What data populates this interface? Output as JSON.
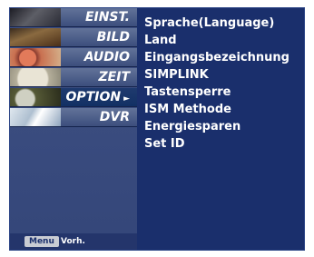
{
  "sidebar": {
    "items": [
      {
        "label": "EINST.",
        "thumbnail": "settings-thumbnail"
      },
      {
        "label": "BILD",
        "thumbnail": "picture-thumbnail"
      },
      {
        "label": "AUDIO",
        "thumbnail": "audio-thumbnail"
      },
      {
        "label": "ZEIT",
        "thumbnail": "clock-thumbnail"
      },
      {
        "label": "OPTION",
        "thumbnail": "special-thumbnail",
        "selected": true,
        "arrow": "►"
      },
      {
        "label": "DVR",
        "thumbnail": "disc-thumbnail"
      }
    ]
  },
  "submenu": {
    "items": [
      "Sprache(Language)",
      "Land",
      "Eingangsbezeichnung",
      "SIMPLINK",
      "Tastensperre",
      "ISM Methode",
      "Energiesparen",
      "Set ID"
    ]
  },
  "footer": {
    "menu_key": "Menu",
    "prev_label": "Vorh."
  },
  "colors": {
    "panel_bg": "#1a2f6c",
    "text": "#ffffff",
    "selected_bg": "#123064"
  }
}
